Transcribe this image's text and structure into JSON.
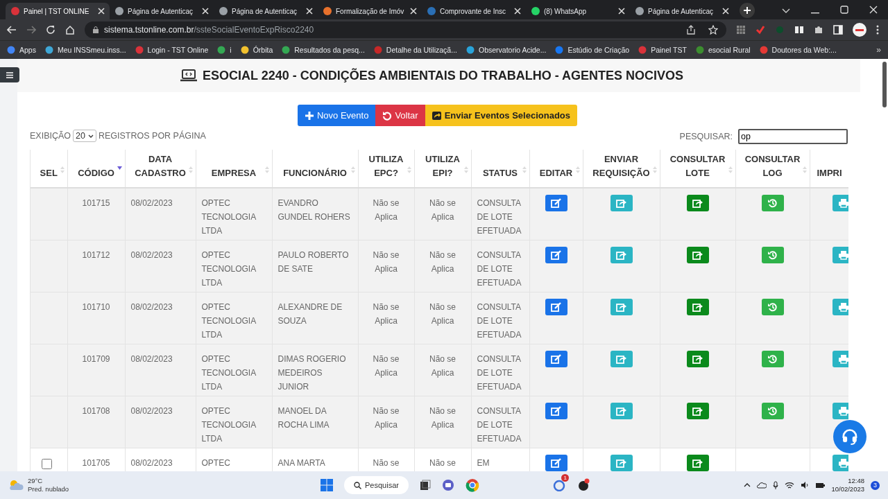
{
  "browser": {
    "tabs": [
      {
        "title": "Painel | TST ONLINE",
        "color": "#d9323a",
        "selected": true
      },
      {
        "title": "Página de Autenticaç",
        "color": "#9aa0a6",
        "selected": false
      },
      {
        "title": "Página de Autenticaç",
        "color": "#9aa0a6",
        "selected": false
      },
      {
        "title": "Formalização de Imóv",
        "color": "#e8712c",
        "selected": false
      },
      {
        "title": "Comprovante de Insc",
        "color": "#2a6fb5",
        "selected": false
      },
      {
        "title": "(8) WhatsApp",
        "color": "#25d366",
        "selected": false
      },
      {
        "title": "Página de Autenticaç",
        "color": "#9aa0a6",
        "selected": false
      }
    ],
    "url_host": "sistema.tstonline.com.br",
    "url_path": "/ssteSocialEventoExpRisco2240",
    "bookmarks": [
      {
        "label": "Apps",
        "color": "#4285f4"
      },
      {
        "label": "Meu INSSmeu.inss...",
        "color": "#3fa7d6"
      },
      {
        "label": "Login - TST Online",
        "color": "#d9323a"
      },
      {
        "label": "i",
        "color": "#34a853"
      },
      {
        "label": "Órbita",
        "color": "#f2c12e"
      },
      {
        "label": "Resultados da pesq...",
        "color": "#34a853"
      },
      {
        "label": "Detalhe da Utilizaçã...",
        "color": "#c62828"
      },
      {
        "label": "Observatorio Acide...",
        "color": "#29a3d9"
      },
      {
        "label": "Estúdio de Criação",
        "color": "#1877f2"
      },
      {
        "label": "Painel TST",
        "color": "#d9323a"
      },
      {
        "label": "esocial Rural",
        "color": "#3c8d2f"
      },
      {
        "label": "Doutores da Web:...",
        "color": "#e53935"
      }
    ],
    "bookmarks_more": "»"
  },
  "page": {
    "title": "ESOCIAL 2240 - CONDIÇÕES AMBIENTAIS DO TRABALHO - AGENTES NOCIVOS",
    "buttons": [
      {
        "kind": "new",
        "label": "Novo Evento"
      },
      {
        "kind": "back",
        "label": "Voltar"
      },
      {
        "kind": "send",
        "label": "Enviar Eventos Selecionados"
      }
    ],
    "show_label": "EXIBIÇÃO",
    "page_size": "20",
    "per_page_label": "REGISTROS POR PÁGINA",
    "search_label": "PESQUISAR:",
    "search_value": "op"
  },
  "table": {
    "columns": [
      {
        "label": "SEL",
        "sorted": false
      },
      {
        "label": "CÓDIGO",
        "sorted": true
      },
      {
        "label": "DATA CADASTRO",
        "sorted": false
      },
      {
        "label": "EMPRESA",
        "sorted": false
      },
      {
        "label": "FUNCIONÁRIO",
        "sorted": false
      },
      {
        "label": "UTILIZA EPC?",
        "sorted": false
      },
      {
        "label": "UTILIZA EPI?",
        "sorted": false
      },
      {
        "label": "STATUS",
        "sorted": false
      },
      {
        "label": "EDITAR",
        "sorted": false
      },
      {
        "label": "ENVIAR REQUISIÇÃO",
        "sorted": false
      },
      {
        "label": "CONSULTAR LOTE",
        "sorted": false
      },
      {
        "label": "CONSULTAR LOG",
        "sorted": false
      },
      {
        "label": "IMPRI"
      }
    ],
    "rows": [
      {
        "selectable": false,
        "code": "101715",
        "date": "08/02/2023",
        "company": "OPTEC TECNOLOGIA LTDA",
        "employee": "EVANDRO GUNDEL ROHERS",
        "epc": "Não se Aplica",
        "epi": "Não se Aplica",
        "status": "CONSULTA DE LOTE EFETUADA",
        "log_available": true
      },
      {
        "selectable": false,
        "code": "101712",
        "date": "08/02/2023",
        "company": "OPTEC TECNOLOGIA LTDA",
        "employee": "PAULO ROBERTO DE SATE",
        "epc": "Não se Aplica",
        "epi": "Não se Aplica",
        "status": "CONSULTA DE LOTE EFETUADA",
        "log_available": true
      },
      {
        "selectable": false,
        "code": "101710",
        "date": "08/02/2023",
        "company": "OPTEC TECNOLOGIA LTDA",
        "employee": "ALEXANDRE DE SOUZA",
        "epc": "Não se Aplica",
        "epi": "Não se Aplica",
        "status": "CONSULTA DE LOTE EFETUADA",
        "log_available": true
      },
      {
        "selectable": false,
        "code": "101709",
        "date": "08/02/2023",
        "company": "OPTEC TECNOLOGIA LTDA",
        "employee": "DIMAS ROGERIO MEDEIROS JUNIOR",
        "epc": "Não se Aplica",
        "epi": "Não se Aplica",
        "status": "CONSULTA DE LOTE EFETUADA",
        "log_available": true
      },
      {
        "selectable": false,
        "code": "101708",
        "date": "08/02/2023",
        "company": "OPTEC TECNOLOGIA LTDA",
        "employee": "MANOEL DA ROCHA LIMA",
        "epc": "Não se Aplica",
        "epi": "Não se Aplica",
        "status": "CONSULTA DE LOTE EFETUADA",
        "log_available": true
      },
      {
        "selectable": true,
        "checked": false,
        "code": "101705",
        "date": "08/02/2023",
        "company": "OPTEC",
        "employee": "ANA MARTA",
        "epc": "Não se",
        "epi": "Não se",
        "status": "EM",
        "log_available": false
      }
    ]
  },
  "taskbar": {
    "temperature": "29°C",
    "weather": "Pred. nublado",
    "search": "Pesquisar",
    "chat_badge": "1",
    "time": "12:48",
    "date": "10/02/2023",
    "notifications": "3"
  }
}
